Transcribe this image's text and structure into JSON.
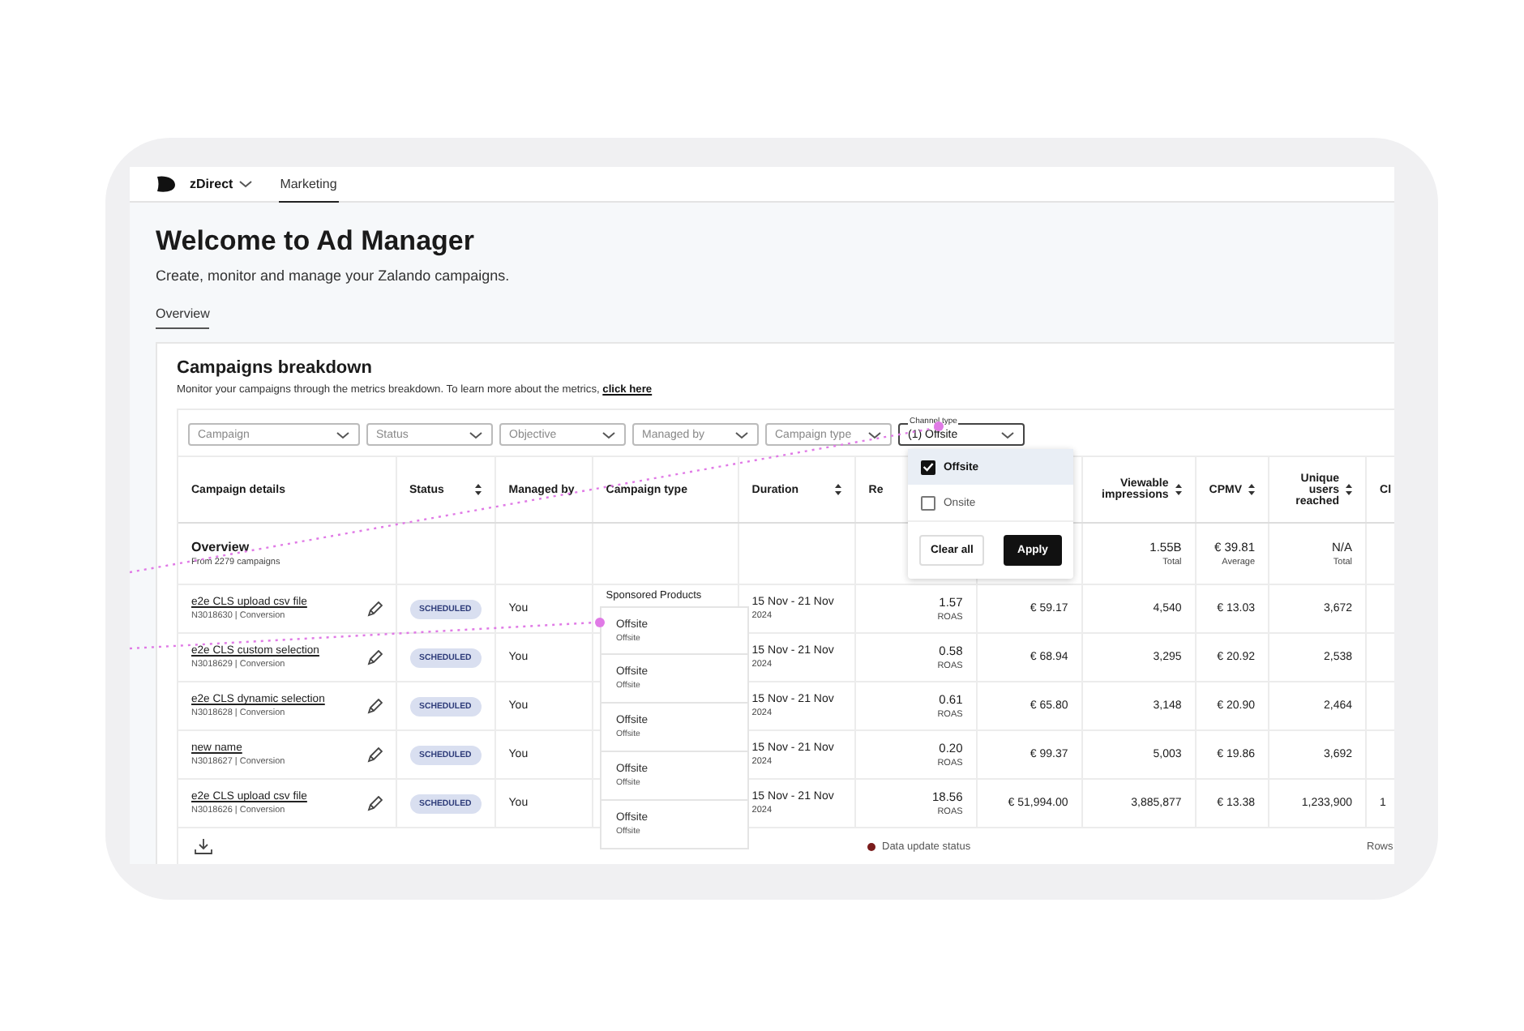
{
  "top_bar": {
    "brand": "zDirect",
    "tabs": [
      {
        "label": "Marketing",
        "selected": true
      }
    ]
  },
  "header": {
    "title": "Welcome to Ad Manager",
    "subtitle": "Create, monitor and manage your Zalando campaigns.",
    "tabs": [
      {
        "label": "Overview",
        "selected": true
      }
    ]
  },
  "card": {
    "title": "Campaigns breakdown",
    "description": "Monitor your campaigns through the metrics breakdown. To learn more about the metrics, **click here**"
  },
  "filters": [
    {
      "placeholder": "Campaign"
    },
    {
      "placeholder": "Status"
    },
    {
      "placeholder": "Objective"
    },
    {
      "placeholder": "Managed by"
    },
    {
      "placeholder": "Campaign type"
    },
    {
      "label": "Channel type",
      "value": "(1) Offsite"
    }
  ],
  "channel_menu": {
    "options": [
      {
        "label": "Offsite",
        "checked": true
      },
      {
        "label": "Onsite",
        "checked": false
      }
    ],
    "buttons": [
      "Clear all",
      "Apply"
    ]
  },
  "table": {
    "columns": [
      {
        "label": "Campaign details",
        "sortable": false
      },
      {
        "label": "Status",
        "sortable": true
      },
      {
        "label": "Managed by",
        "sortable": false
      },
      {
        "label": "Campaign type",
        "sortable": false
      },
      {
        "label": "Duration",
        "sortable": true
      },
      {
        "label": "Re"
      },
      {
        "label": "Viewable impressions",
        "sortable": true
      },
      {
        "label": "CPMV",
        "sortable": true
      },
      {
        "label": "Unique users reached",
        "sortable": true
      },
      {
        "label": "Cl",
        "sortable": false
      }
    ],
    "overview": {
      "title": "Overview",
      "subtitle": "From 2279 campaigns",
      "viewable": {
        "value": "1.55B",
        "note": "Total"
      },
      "cpmv": {
        "value": "€ 39.81",
        "note": "Average"
      },
      "unique_users": {
        "value": "N/A",
        "note": "Total"
      }
    },
    "rows": [
      {
        "name": "e2e CLS upload csv file",
        "meta": "N3018630 | Conversion",
        "status": "SCHEDULED",
        "managed_by": "You",
        "campaign_type": "Sponsored Products",
        "duration": "15 Nov - 21 Nov",
        "duration_year": "2024",
        "roas": "1.57",
        "roas_label": "ROAS",
        "column_7": "€ 59.17",
        "viewable": "4,540",
        "cpmv": "€ 13.03",
        "unique_users": "3,672"
      },
      {
        "name": "e2e CLS custom selection",
        "meta": "N3018629 | Conversion",
        "status": "SCHEDULED",
        "managed_by": "You",
        "duration": "15 Nov - 21 Nov",
        "duration_year": "2024",
        "roas": "0.58",
        "roas_label": "ROAS",
        "column_7": "€ 68.94",
        "viewable": "3,295",
        "cpmv": "€ 20.92",
        "unique_users": "2,538"
      },
      {
        "name": "e2e CLS dynamic selection",
        "meta": "N3018628 | Conversion",
        "status": "SCHEDULED",
        "managed_by": "You",
        "duration": "15 Nov - 21 Nov",
        "duration_year": "2024",
        "roas": "0.61",
        "roas_label": "ROAS",
        "column_7": "€ 65.80",
        "viewable": "3,148",
        "cpmv": "€ 20.90",
        "unique_users": "2,464"
      },
      {
        "name": "new name",
        "meta": "N3018627 | Conversion",
        "status": "SCHEDULED",
        "managed_by": "You",
        "duration": "15 Nov - 21 Nov",
        "duration_year": "2024",
        "roas": "0.20",
        "roas_label": "ROAS",
        "column_7": "€ 99.37",
        "viewable": "5,003",
        "cpmv": "€ 19.86",
        "unique_users": "3,692"
      },
      {
        "name": "e2e CLS upload csv file",
        "meta": "N3018626 | Conversion",
        "status": "SCHEDULED",
        "managed_by": "You",
        "duration": "15 Nov - 21 Nov",
        "duration_year": "2024",
        "roas": "18.56",
        "roas_label": "ROAS",
        "column_7": "€ 51,994.00",
        "viewable": "3,885,877",
        "cpmv": "€ 13.38",
        "unique_users": "1,233,900",
        "column_11": "1"
      }
    ]
  },
  "channel_popover": [
    {
      "title": "Offsite",
      "subtitle": "Offsite"
    },
    {
      "title": "Offsite",
      "subtitle": "Offsite"
    },
    {
      "title": "Offsite",
      "subtitle": "Offsite"
    },
    {
      "title": "Offsite",
      "subtitle": "Offsite"
    },
    {
      "title": "Offsite",
      "subtitle": "Offsite"
    }
  ],
  "footer": {
    "status_label": "Data update status",
    "rows_label": "Rows"
  }
}
